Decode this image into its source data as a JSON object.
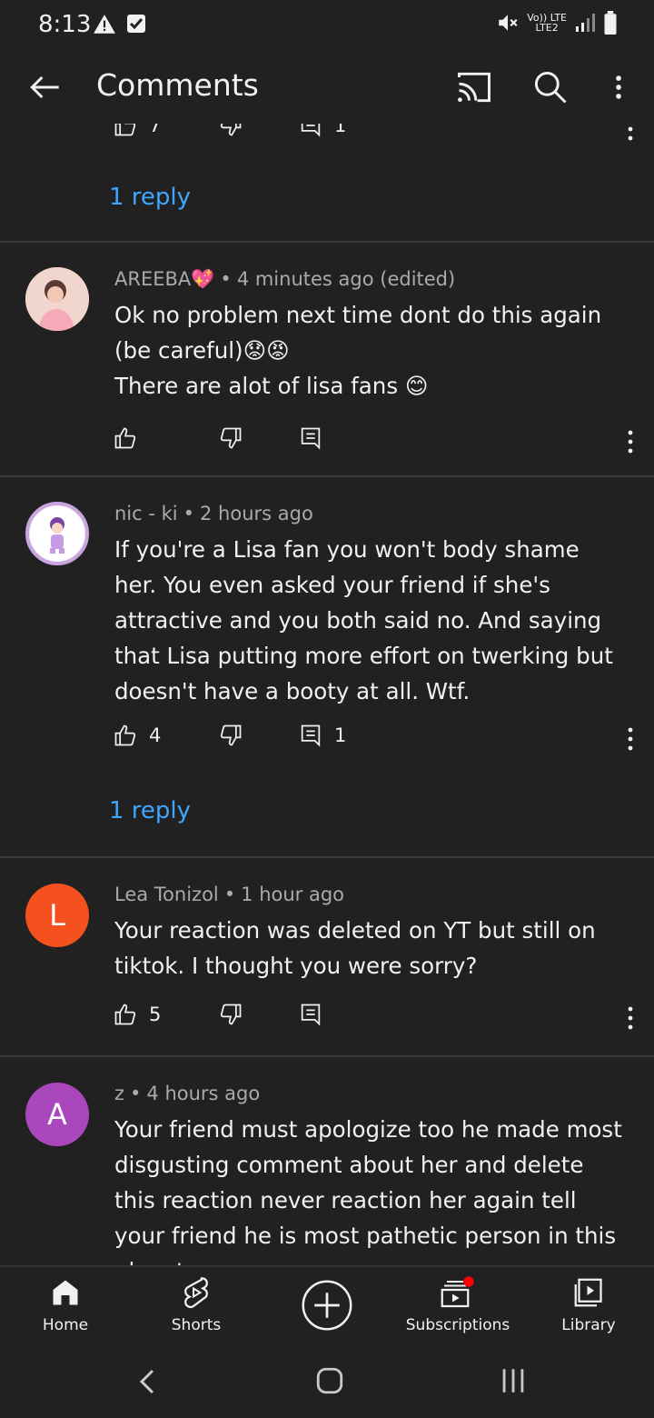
{
  "status": {
    "time": "8:13",
    "signal_text": "Vo)) LTE",
    "signal_sub": "LTE2"
  },
  "appbar": {
    "title": "Comments"
  },
  "top_partial": {
    "like_count": "7",
    "reply_count": "1",
    "reply_link": "1 reply"
  },
  "comments": [
    {
      "author": "AREEBA💖",
      "time": "4 minutes ago (edited)",
      "lines": [
        "Ok no problem next time dont do this again (be careful)😟😡",
        "There are alot of lisa fans 😊"
      ],
      "likes": "",
      "replies": ""
    },
    {
      "author": "nic - ki",
      "time": "2 hours ago",
      "lines": [
        "If you're a Lisa fan you won't body shame her. You even asked your friend if she's attractive and you both said no. And saying that Lisa putting more effort on twerking but doesn't have a booty at all. Wtf."
      ],
      "likes": "4",
      "replies": "1",
      "reply_link": "1 reply"
    },
    {
      "author": "Lea Tonizol",
      "time": "1 hour ago",
      "initial": "L",
      "avatar_color": "#f4511e",
      "lines": [
        "Your reaction was deleted on YT but still on tiktok. I thought you were sorry?"
      ],
      "likes": "5",
      "replies": ""
    },
    {
      "author": "z",
      "time": "4 hours ago",
      "initial": "A",
      "avatar_color": "#ab47bc",
      "lines": [
        "Your friend must apologize too he made most disgusting comment about her and delete this reaction never reaction her again tell your friend he is most pathetic person in this planet"
      ],
      "likes": "",
      "replies": ""
    }
  ],
  "bottom_nav": [
    {
      "label": "Home",
      "icon": "home-icon"
    },
    {
      "label": "Shorts",
      "icon": "shorts-icon"
    },
    {
      "label": "",
      "icon": "create-icon"
    },
    {
      "label": "Subscriptions",
      "icon": "subscriptions-icon"
    },
    {
      "label": "Library",
      "icon": "library-icon"
    }
  ],
  "colors": {
    "background": "#212121",
    "link": "#3ea6ff",
    "meta": "#aaaaaa"
  }
}
